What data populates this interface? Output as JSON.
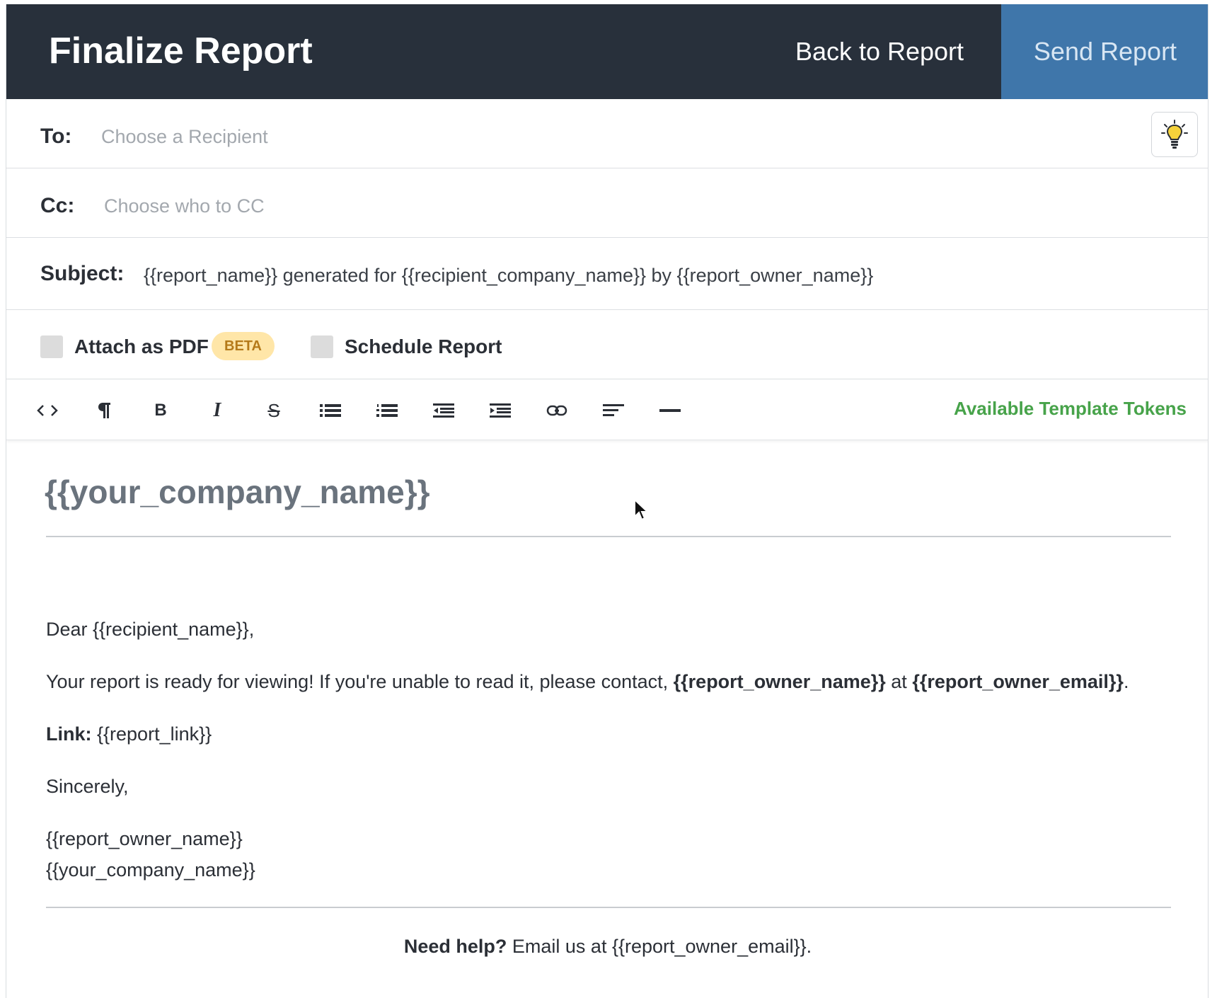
{
  "header": {
    "title": "Finalize Report",
    "back_label": "Back to Report",
    "send_label": "Send Report"
  },
  "fields": {
    "to_label": "To:",
    "to_placeholder": "Choose a Recipient",
    "cc_label": "Cc:",
    "cc_placeholder": "Choose who to CC",
    "subject_label": "Subject:",
    "subject_value": "{{report_name}} generated for {{recipient_company_name}} by {{report_owner_name}}"
  },
  "options": {
    "attach_pdf_label": "Attach as PDF",
    "beta_badge": "BETA",
    "schedule_label": "Schedule Report"
  },
  "toolbar": {
    "tools": [
      "code-icon",
      "paragraph-icon",
      "bold-icon",
      "italic-icon",
      "strikethrough-icon",
      "bulleted-list-icon",
      "numbered-list-icon",
      "outdent-icon",
      "indent-icon",
      "link-icon",
      "align-left-icon",
      "horizontal-rule-icon"
    ],
    "bold_glyph": "B",
    "italic_glyph": "I",
    "strike_glyph": "S",
    "tokens_label": "Available Template Tokens"
  },
  "editor": {
    "company_heading": "{{your_company_name}}",
    "greeting": "Dear {{recipient_name}},",
    "body_prefix": "Your report is ready for viewing! If you're unable to read it, please contact, ",
    "body_owner": "{{report_owner_name}}",
    "body_at": " at ",
    "body_email": "{{report_owner_email}}",
    "body_suffix": ".",
    "link_label": "Link:",
    "link_value": " {{report_link}}",
    "sincerely": "Sincerely,",
    "signature_name": "{{report_owner_name}}",
    "signature_company": "{{your_company_name}}",
    "help_bold": "Need help?",
    "help_text": " Email us at {{report_owner_email}}."
  },
  "colors": {
    "header_bg": "#28303b",
    "send_bg": "#3f76aa",
    "tokens_green": "#47a34a",
    "beta_bg": "#ffe6a8"
  }
}
